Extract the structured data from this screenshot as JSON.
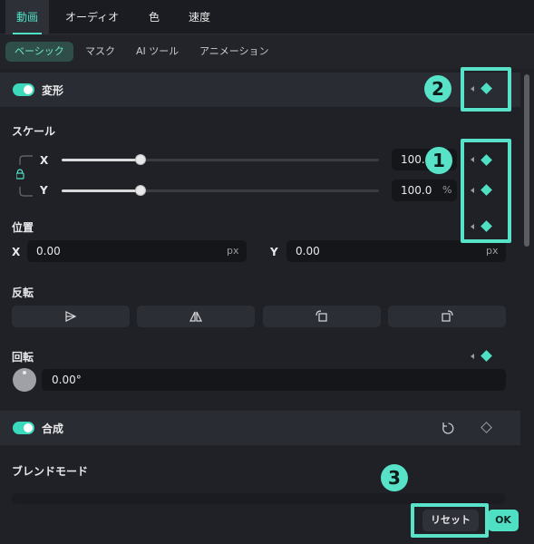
{
  "top_tabs": [
    {
      "label": "動画",
      "active": true
    },
    {
      "label": "オーディオ",
      "active": false
    },
    {
      "label": "色",
      "active": false
    },
    {
      "label": "速度",
      "active": false
    }
  ],
  "sub_tabs": [
    {
      "label": "ベーシック",
      "active": true
    },
    {
      "label": "マスク",
      "active": false
    },
    {
      "label": "AI ツール",
      "active": false
    },
    {
      "label": "アニメーション",
      "active": false
    }
  ],
  "transform": {
    "title": "変形",
    "enabled": true,
    "scale": {
      "label": "スケール",
      "x_label": "X",
      "x_value": "100.0",
      "y_label": "Y",
      "y_value": "100.0",
      "unit": "%",
      "x_slider_fraction": 0.25,
      "y_slider_fraction": 0.25
    },
    "position": {
      "label": "位置",
      "x_label": "X",
      "x_value": "0.00",
      "y_label": "Y",
      "y_value": "0.00",
      "unit": "px"
    },
    "flip": {
      "label": "反転"
    },
    "rotation": {
      "label": "回転",
      "value": "0.00°"
    }
  },
  "composite": {
    "title": "合成",
    "enabled": true,
    "blend_mode_label": "ブレンドモード"
  },
  "buttons": {
    "reset": "リセット",
    "ok": "OK"
  },
  "annotations": [
    "1",
    "2",
    "3"
  ],
  "colors": {
    "accent": "#4fe0c4",
    "highlight": "#58e3c8",
    "background": "#1f2127"
  }
}
